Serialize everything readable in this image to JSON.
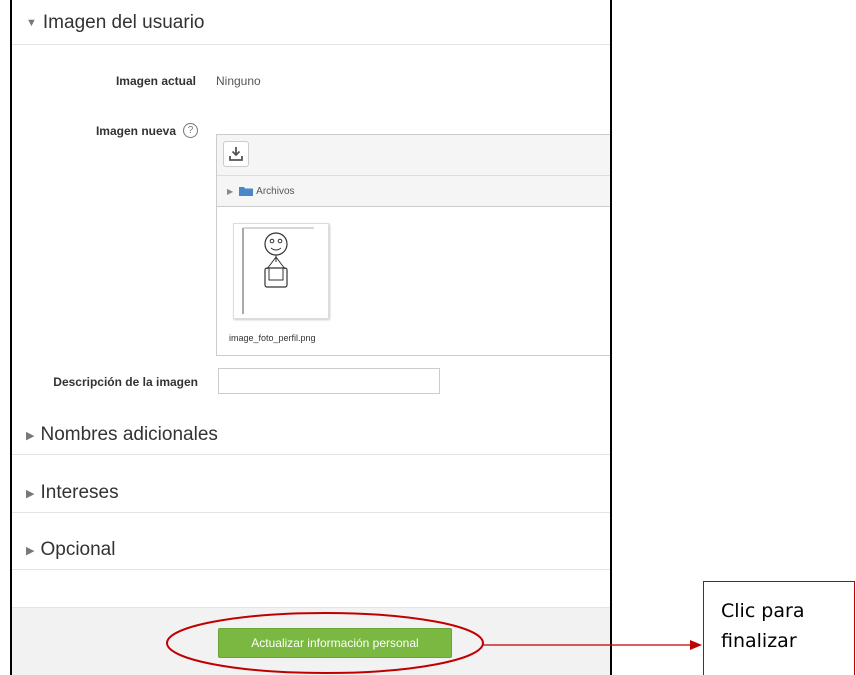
{
  "sections": {
    "user_image_title": "Imagen del usuario",
    "additional_names_title": "Nombres adicionales",
    "interests_title": "Intereses",
    "optional_title": "Opcional"
  },
  "fields": {
    "current_image_label": "Imagen actual",
    "current_image_value": "Ninguno",
    "new_image_label": "Imagen nueva",
    "help_glyph": "?",
    "folder_label": "Archivos",
    "file_name": "image_foto_perfil.png",
    "description_label": "Descripción de la imagen",
    "description_value": ""
  },
  "footer": {
    "submit_label": "Actualizar información personal"
  },
  "annotation": {
    "line1": "Clic para",
    "line2": "finalizar",
    "color": "#c00000"
  },
  "colors": {
    "submit_button": "#7ab841",
    "folder_icon": "#4a86c8"
  }
}
